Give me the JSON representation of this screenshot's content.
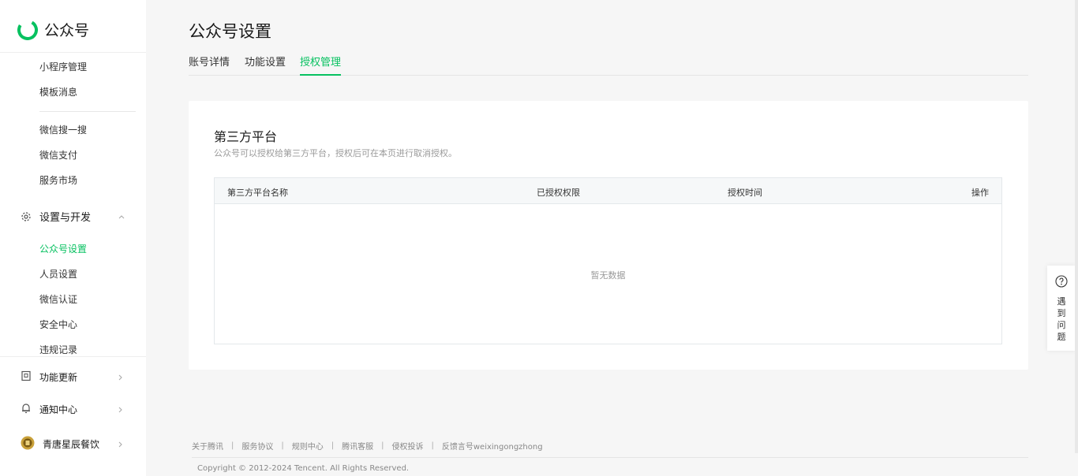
{
  "brand": {
    "name": "公众号",
    "accent": "#07c160"
  },
  "sidebar": {
    "items_top": [
      {
        "label": "小程序管理"
      },
      {
        "label": "模板消息"
      }
    ],
    "items_mid": [
      {
        "label": "微信搜一搜"
      },
      {
        "label": "微信支付"
      },
      {
        "label": "服务市场"
      }
    ],
    "group": {
      "label": "设置与开发",
      "icon": "gear-icon",
      "expanded": true
    },
    "group_items": [
      {
        "label": "公众号设置",
        "active": true
      },
      {
        "label": "人员设置"
      },
      {
        "label": "微信认证"
      },
      {
        "label": "安全中心"
      },
      {
        "label": "违规记录"
      }
    ],
    "bottom": [
      {
        "label": "功能更新",
        "icon": "notebook-icon"
      },
      {
        "label": "通知中心",
        "icon": "bell-icon"
      },
      {
        "label": "青唐星辰餐饮",
        "icon": "avatar"
      }
    ]
  },
  "header": {
    "title": "公众号设置"
  },
  "tabs": [
    {
      "label": "账号详情"
    },
    {
      "label": "功能设置"
    },
    {
      "label": "授权管理",
      "active": true
    }
  ],
  "card": {
    "title": "第三方平台",
    "description": "公众号可以授权给第三方平台，授权后可在本页进行取消授权。",
    "table": {
      "columns": [
        "第三方平台名称",
        "已授权权限",
        "授权时间",
        "操作"
      ],
      "rows": [],
      "empty_text": "暂无数据"
    }
  },
  "footer": {
    "links": [
      "关于腾讯",
      "服务协议",
      "规则中心",
      "腾讯客服",
      "侵权投诉",
      "反馈言号weixingongzhong"
    ],
    "copyright": "Copyright © 2012-2024 Tencent. All Rights Reserved."
  },
  "help": {
    "text": "遇到问题",
    "icon": "question-icon"
  }
}
